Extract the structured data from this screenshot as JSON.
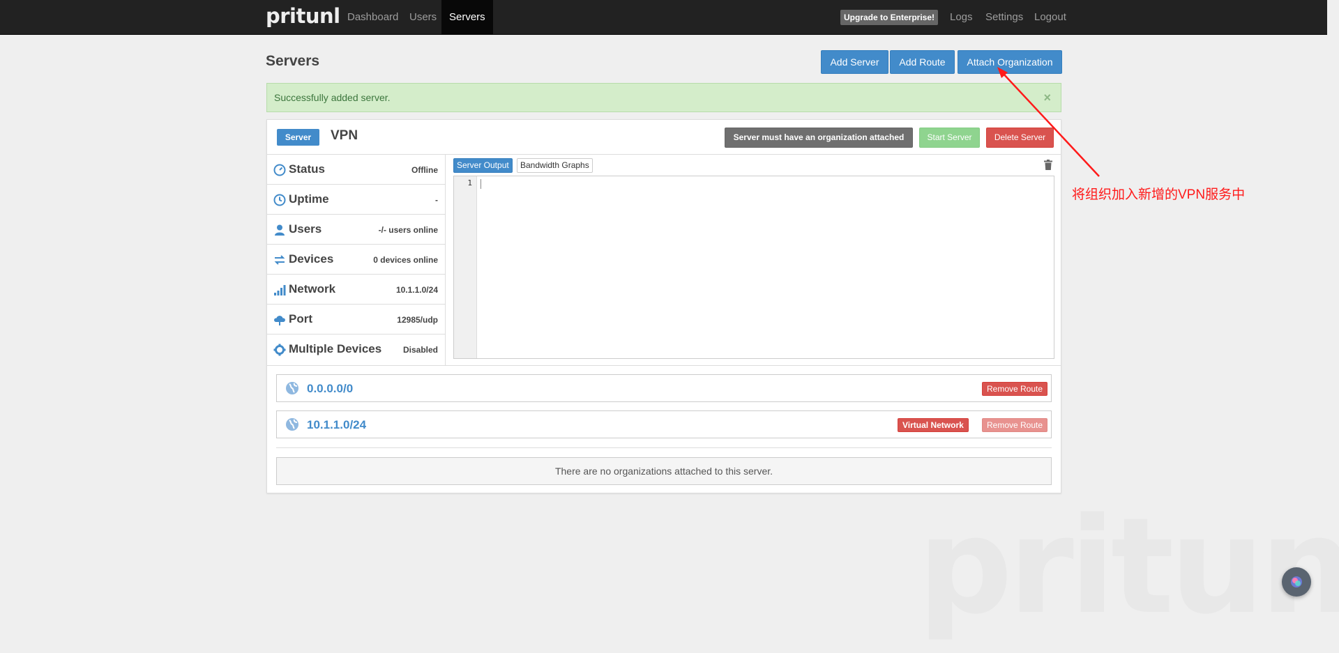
{
  "navbar": {
    "brand": "pritunl",
    "links": [
      "Dashboard",
      "Users",
      "Servers"
    ],
    "active": "Servers",
    "enterprise": "Upgrade to Enterprise!",
    "right_links": [
      "Logs",
      "Settings",
      "Logout"
    ]
  },
  "page": {
    "title": "Servers",
    "add_server": "Add Server",
    "add_route": "Add Route",
    "attach_org": "Attach Organization"
  },
  "alert": {
    "message": "Successfully added server.",
    "close": "×"
  },
  "server": {
    "label": "Server",
    "name": "VPN",
    "status_warning": "Server must have an organization attached",
    "start": "Start Server",
    "delete": "Delete Server",
    "stats": [
      {
        "label": "Status",
        "value": "Offline",
        "icon": "speedometer-icon"
      },
      {
        "label": "Uptime",
        "value": "-",
        "icon": "clock-icon"
      },
      {
        "label": "Users",
        "value": "-/- users online",
        "icon": "user-icon"
      },
      {
        "label": "Devices",
        "value": "0 devices online",
        "icon": "transfer-icon"
      },
      {
        "label": "Network",
        "value": "10.1.1.0/24",
        "icon": "signal-icon"
      },
      {
        "label": "Port",
        "value": "12985/udp",
        "icon": "cloud-upload-icon"
      },
      {
        "label": "Multiple Devices",
        "value": "Disabled",
        "icon": "gear-icon"
      }
    ],
    "tabs": [
      "Server Output",
      "Bandwidth Graphs"
    ],
    "output_line": "1",
    "routes": [
      {
        "network": "0.0.0.0/0",
        "remove": "Remove Route"
      },
      {
        "network": "10.1.1.0/24",
        "virtual": "Virtual Network",
        "remove": "Remove Route"
      }
    ],
    "no_orgs": "There are no organizations attached to this server."
  },
  "annotation": {
    "text": "将组织加入新增的VPN服务中",
    "color": "#ff1a1a"
  },
  "watermark": "pritunl",
  "colors": {
    "primary": "#428bca",
    "danger": "#d9534f",
    "success": "#5cb85c",
    "navbar": "#222222"
  }
}
